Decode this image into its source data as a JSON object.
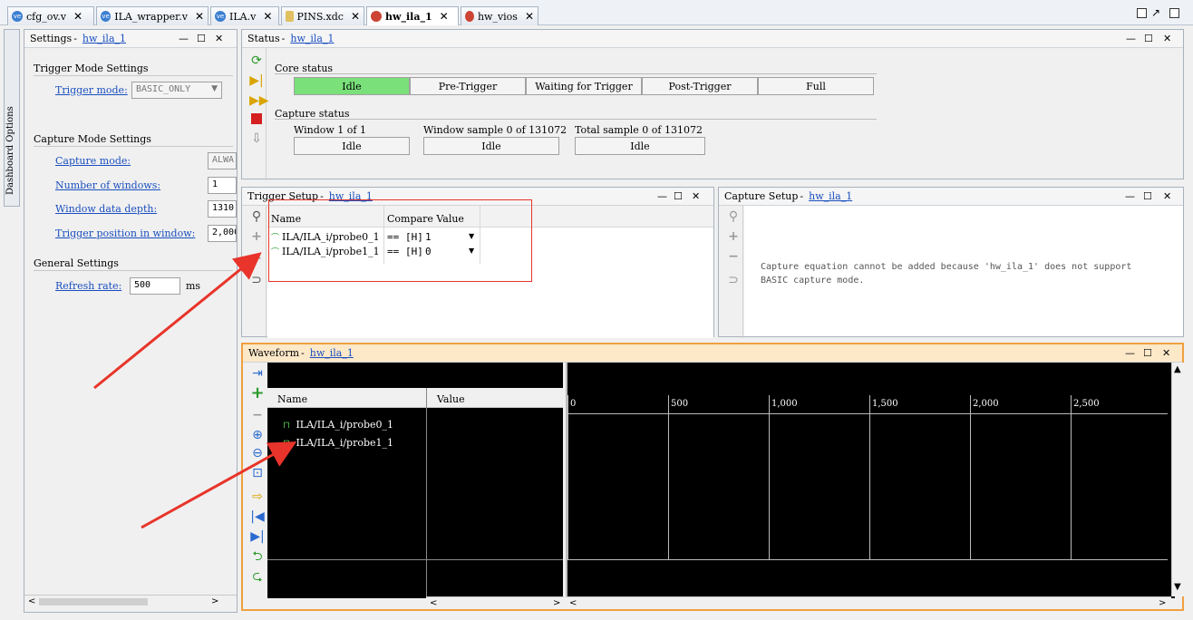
{
  "tabs": [
    {
      "label": "cfg_ov.v",
      "icon": "verilog-file-icon",
      "active": false
    },
    {
      "label": "ILA_wrapper.v",
      "icon": "verilog-file-icon",
      "active": false
    },
    {
      "label": "ILA.v",
      "icon": "verilog-file-icon",
      "active": false
    },
    {
      "label": "PINS.xdc",
      "icon": "xdc-file-icon",
      "active": false
    },
    {
      "label": "hw_ila_1",
      "icon": "hw-ila-icon",
      "active": true
    },
    {
      "label": "hw_vios",
      "icon": "hw-vio-icon",
      "active": false
    }
  ],
  "dashboard_options": "Dashboard Options",
  "settings": {
    "title": "Settings",
    "title_link": "hw_ila_1",
    "trigger_mode_section": "Trigger Mode Settings",
    "trigger_mode_label": "Trigger mode:",
    "trigger_mode_value": "BASIC_ONLY",
    "capture_mode_section": "Capture Mode Settings",
    "capture_mode_label": "Capture mode:",
    "capture_mode_value": "ALWA",
    "num_windows_label": "Number of windows:",
    "num_windows_value": "1",
    "window_depth_label": "Window data depth:",
    "window_depth_value": "1310",
    "trigger_pos_label": "Trigger position in window:",
    "trigger_pos_value": "2,000",
    "general_section": "General Settings",
    "refresh_label": "Refresh rate:",
    "refresh_value": "500",
    "refresh_unit": "ms"
  },
  "status": {
    "title": "Status",
    "title_link": "hw_ila_1",
    "core_status_label": "Core status",
    "core_states": [
      "Idle",
      "Pre-Trigger",
      "Waiting for Trigger",
      "Post-Trigger",
      "Full"
    ],
    "active_state_index": 0,
    "capture_status_label": "Capture status",
    "window_label": "Window 1 of 1",
    "window_value": "Idle",
    "window_sample_label": "Window sample 0 of 131072",
    "window_sample_value": "Idle",
    "total_sample_label": "Total sample 0 of 131072",
    "total_sample_value": "Idle"
  },
  "trigger_setup": {
    "title": "Trigger Setup",
    "title_link": "hw_ila_1",
    "col_name": "Name",
    "col_compare": "Compare Value",
    "rows": [
      {
        "name": "ILA/ILA_i/probe0_1",
        "op": "==",
        "radix": "[H]",
        "value": "1"
      },
      {
        "name": "ILA/ILA_i/probe1_1",
        "op": "==",
        "radix": "[H]",
        "value": "0"
      }
    ]
  },
  "capture_setup": {
    "title": "Capture Setup",
    "title_link": "hw_ila_1",
    "message_line1": "Capture equation cannot be added because 'hw_ila_1' does not support",
    "message_line2": "BASIC capture mode."
  },
  "waveform": {
    "title": "Waveform",
    "title_link": "hw_ila_1",
    "col_name": "Name",
    "col_value": "Value",
    "signals": [
      "ILA/ILA_i/probe0_1",
      "ILA/ILA_i/probe1_1"
    ],
    "ticks": [
      "0",
      "500",
      "1,000",
      "1,500",
      "2,000",
      "2,500"
    ]
  },
  "colors": {
    "accent_link": "#1a4fbf",
    "active_state": "#7ae07a",
    "annotation_red": "#e8342a",
    "waveform_border": "#f0a040"
  }
}
